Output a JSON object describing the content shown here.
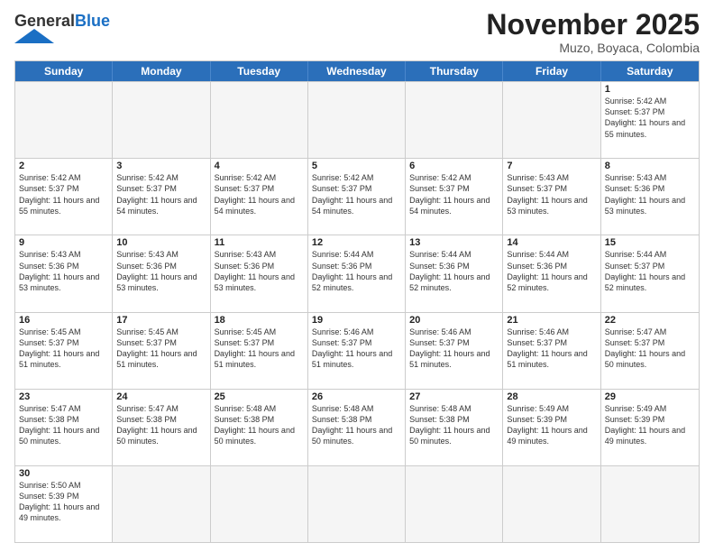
{
  "header": {
    "logo_general": "General",
    "logo_blue": "Blue",
    "month_title": "November 2025",
    "subtitle": "Muzo, Boyaca, Colombia"
  },
  "days_of_week": [
    "Sunday",
    "Monday",
    "Tuesday",
    "Wednesday",
    "Thursday",
    "Friday",
    "Saturday"
  ],
  "weeks": [
    [
      {
        "day": "",
        "empty": true
      },
      {
        "day": "",
        "empty": true
      },
      {
        "day": "",
        "empty": true
      },
      {
        "day": "",
        "empty": true
      },
      {
        "day": "",
        "empty": true
      },
      {
        "day": "",
        "empty": true
      },
      {
        "day": "1",
        "sunrise": "5:42 AM",
        "sunset": "5:37 PM",
        "daylight": "11 hours and 55 minutes."
      }
    ],
    [
      {
        "day": "2",
        "sunrise": "5:42 AM",
        "sunset": "5:37 PM",
        "daylight": "11 hours and 55 minutes."
      },
      {
        "day": "3",
        "sunrise": "5:42 AM",
        "sunset": "5:37 PM",
        "daylight": "11 hours and 54 minutes."
      },
      {
        "day": "4",
        "sunrise": "5:42 AM",
        "sunset": "5:37 PM",
        "daylight": "11 hours and 54 minutes."
      },
      {
        "day": "5",
        "sunrise": "5:42 AM",
        "sunset": "5:37 PM",
        "daylight": "11 hours and 54 minutes."
      },
      {
        "day": "6",
        "sunrise": "5:42 AM",
        "sunset": "5:37 PM",
        "daylight": "11 hours and 54 minutes."
      },
      {
        "day": "7",
        "sunrise": "5:43 AM",
        "sunset": "5:37 PM",
        "daylight": "11 hours and 53 minutes."
      },
      {
        "day": "8",
        "sunrise": "5:43 AM",
        "sunset": "5:36 PM",
        "daylight": "11 hours and 53 minutes."
      }
    ],
    [
      {
        "day": "9",
        "sunrise": "5:43 AM",
        "sunset": "5:36 PM",
        "daylight": "11 hours and 53 minutes."
      },
      {
        "day": "10",
        "sunrise": "5:43 AM",
        "sunset": "5:36 PM",
        "daylight": "11 hours and 53 minutes."
      },
      {
        "day": "11",
        "sunrise": "5:43 AM",
        "sunset": "5:36 PM",
        "daylight": "11 hours and 53 minutes."
      },
      {
        "day": "12",
        "sunrise": "5:44 AM",
        "sunset": "5:36 PM",
        "daylight": "11 hours and 52 minutes."
      },
      {
        "day": "13",
        "sunrise": "5:44 AM",
        "sunset": "5:36 PM",
        "daylight": "11 hours and 52 minutes."
      },
      {
        "day": "14",
        "sunrise": "5:44 AM",
        "sunset": "5:36 PM",
        "daylight": "11 hours and 52 minutes."
      },
      {
        "day": "15",
        "sunrise": "5:44 AM",
        "sunset": "5:37 PM",
        "daylight": "11 hours and 52 minutes."
      }
    ],
    [
      {
        "day": "16",
        "sunrise": "5:45 AM",
        "sunset": "5:37 PM",
        "daylight": "11 hours and 51 minutes."
      },
      {
        "day": "17",
        "sunrise": "5:45 AM",
        "sunset": "5:37 PM",
        "daylight": "11 hours and 51 minutes."
      },
      {
        "day": "18",
        "sunrise": "5:45 AM",
        "sunset": "5:37 PM",
        "daylight": "11 hours and 51 minutes."
      },
      {
        "day": "19",
        "sunrise": "5:46 AM",
        "sunset": "5:37 PM",
        "daylight": "11 hours and 51 minutes."
      },
      {
        "day": "20",
        "sunrise": "5:46 AM",
        "sunset": "5:37 PM",
        "daylight": "11 hours and 51 minutes."
      },
      {
        "day": "21",
        "sunrise": "5:46 AM",
        "sunset": "5:37 PM",
        "daylight": "11 hours and 51 minutes."
      },
      {
        "day": "22",
        "sunrise": "5:47 AM",
        "sunset": "5:37 PM",
        "daylight": "11 hours and 50 minutes."
      }
    ],
    [
      {
        "day": "23",
        "sunrise": "5:47 AM",
        "sunset": "5:38 PM",
        "daylight": "11 hours and 50 minutes."
      },
      {
        "day": "24",
        "sunrise": "5:47 AM",
        "sunset": "5:38 PM",
        "daylight": "11 hours and 50 minutes."
      },
      {
        "day": "25",
        "sunrise": "5:48 AM",
        "sunset": "5:38 PM",
        "daylight": "11 hours and 50 minutes."
      },
      {
        "day": "26",
        "sunrise": "5:48 AM",
        "sunset": "5:38 PM",
        "daylight": "11 hours and 50 minutes."
      },
      {
        "day": "27",
        "sunrise": "5:48 AM",
        "sunset": "5:38 PM",
        "daylight": "11 hours and 50 minutes."
      },
      {
        "day": "28",
        "sunrise": "5:49 AM",
        "sunset": "5:39 PM",
        "daylight": "11 hours and 49 minutes."
      },
      {
        "day": "29",
        "sunrise": "5:49 AM",
        "sunset": "5:39 PM",
        "daylight": "11 hours and 49 minutes."
      }
    ],
    [
      {
        "day": "30",
        "sunrise": "5:50 AM",
        "sunset": "5:39 PM",
        "daylight": "11 hours and 49 minutes."
      },
      {
        "day": "",
        "empty": true
      },
      {
        "day": "",
        "empty": true
      },
      {
        "day": "",
        "empty": true
      },
      {
        "day": "",
        "empty": true
      },
      {
        "day": "",
        "empty": true
      },
      {
        "day": "",
        "empty": true
      }
    ]
  ],
  "labels": {
    "sunrise": "Sunrise:",
    "sunset": "Sunset:",
    "daylight": "Daylight:"
  }
}
